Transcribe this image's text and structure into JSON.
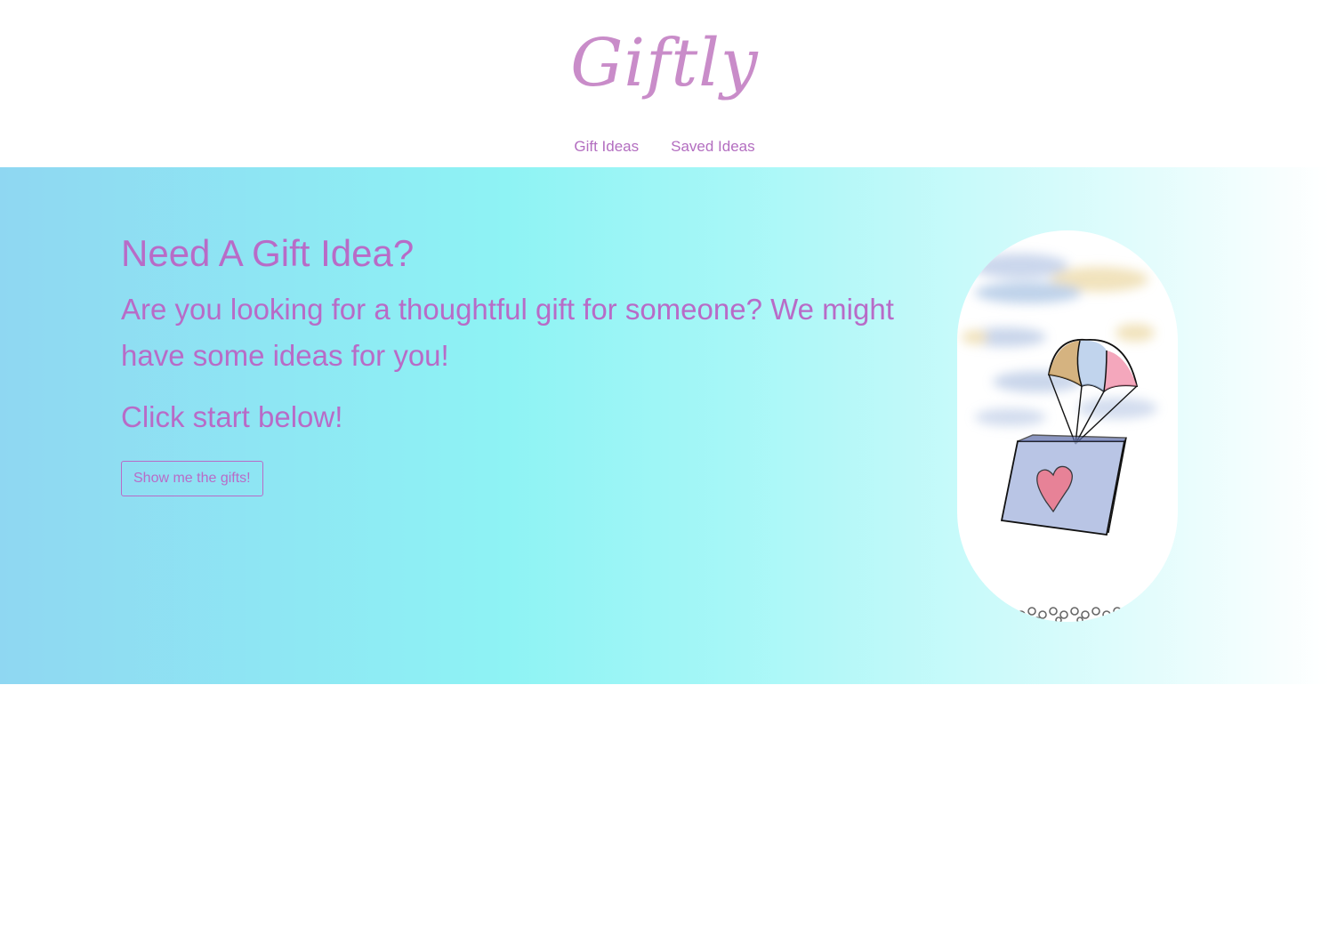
{
  "header": {
    "logo": "Giftly",
    "nav": [
      {
        "label": "Gift Ideas"
      },
      {
        "label": "Saved Ideas"
      }
    ]
  },
  "hero": {
    "heading": "Need A Gift Idea?",
    "subheading": "Are you looking for a thoughtful gift for someone? We might have some ideas for you!",
    "cta_text": "Click start below!",
    "button_label": "Show me the gifts!",
    "image_alt": "parachute-gift-box-illustration"
  },
  "colors": {
    "accent": "#b86bc7",
    "logo": "#c98cc9",
    "hero_gradient_start": "#8fd7f2",
    "hero_gradient_mid": "#8ef3f4",
    "hero_gradient_end": "#ffffff"
  }
}
